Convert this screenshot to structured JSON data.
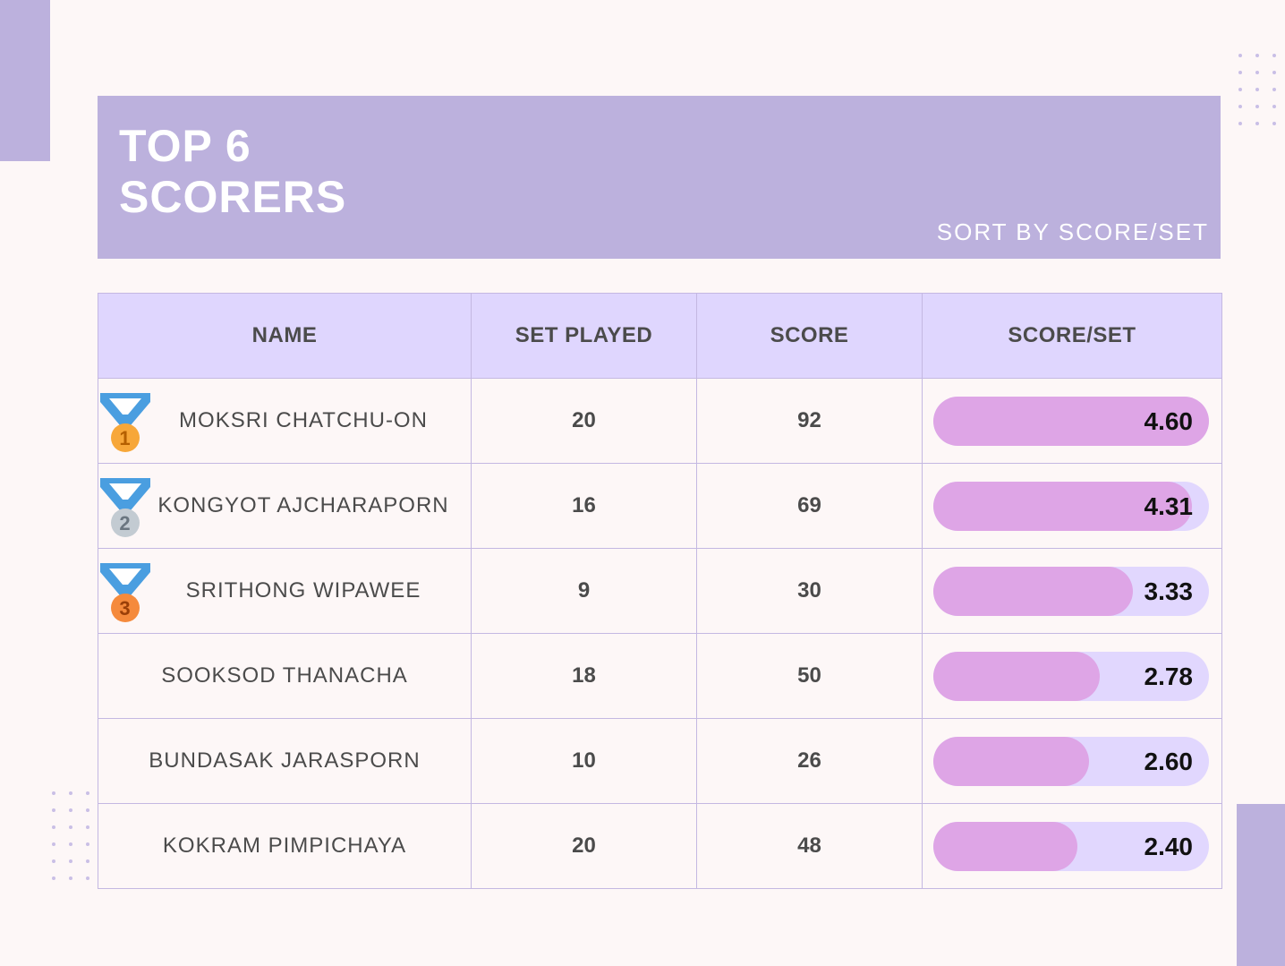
{
  "title_line1": "TOP 6",
  "title_line2": "SCORERS",
  "subtitle": "SORT BY SCORE/SET",
  "colors": {
    "banner": "#bcb1dd",
    "header_bg": "#dfd6fe",
    "bar_fill": "#dea5e6",
    "bar_track": "#e1d7fe",
    "background": "#fdf7f7"
  },
  "chart_data": {
    "type": "table",
    "columns": [
      "NAME",
      "SET PLAYED",
      "SCORE",
      "SCORE/SET"
    ],
    "rows": [
      {
        "name": "MOKSRI CHATCHU-ON",
        "sets": "20",
        "score": "92",
        "ratio": "4.60",
        "ratio_value": 4.6,
        "medal": "1"
      },
      {
        "name": "KONGYOT AJCHARAPORN",
        "sets": "16",
        "score": "69",
        "ratio": "4.31",
        "ratio_value": 4.31,
        "medal": "2"
      },
      {
        "name": "SRITHONG WIPAWEE",
        "sets": "9",
        "score": "30",
        "ratio": "3.33",
        "ratio_value": 3.33,
        "medal": "3"
      },
      {
        "name": "SOOKSOD THANACHA",
        "sets": "18",
        "score": "50",
        "ratio": "2.78",
        "ratio_value": 2.78,
        "medal": null
      },
      {
        "name": "BUNDASAK JARASPORN",
        "sets": "10",
        "score": "26",
        "ratio": "2.60",
        "ratio_value": 2.6,
        "medal": null
      },
      {
        "name": "KOKRAM PIMPICHAYA",
        "sets": "20",
        "score": "48",
        "ratio": "2.40",
        "ratio_value": 2.4,
        "medal": null
      }
    ],
    "bar_max": 4.6
  }
}
